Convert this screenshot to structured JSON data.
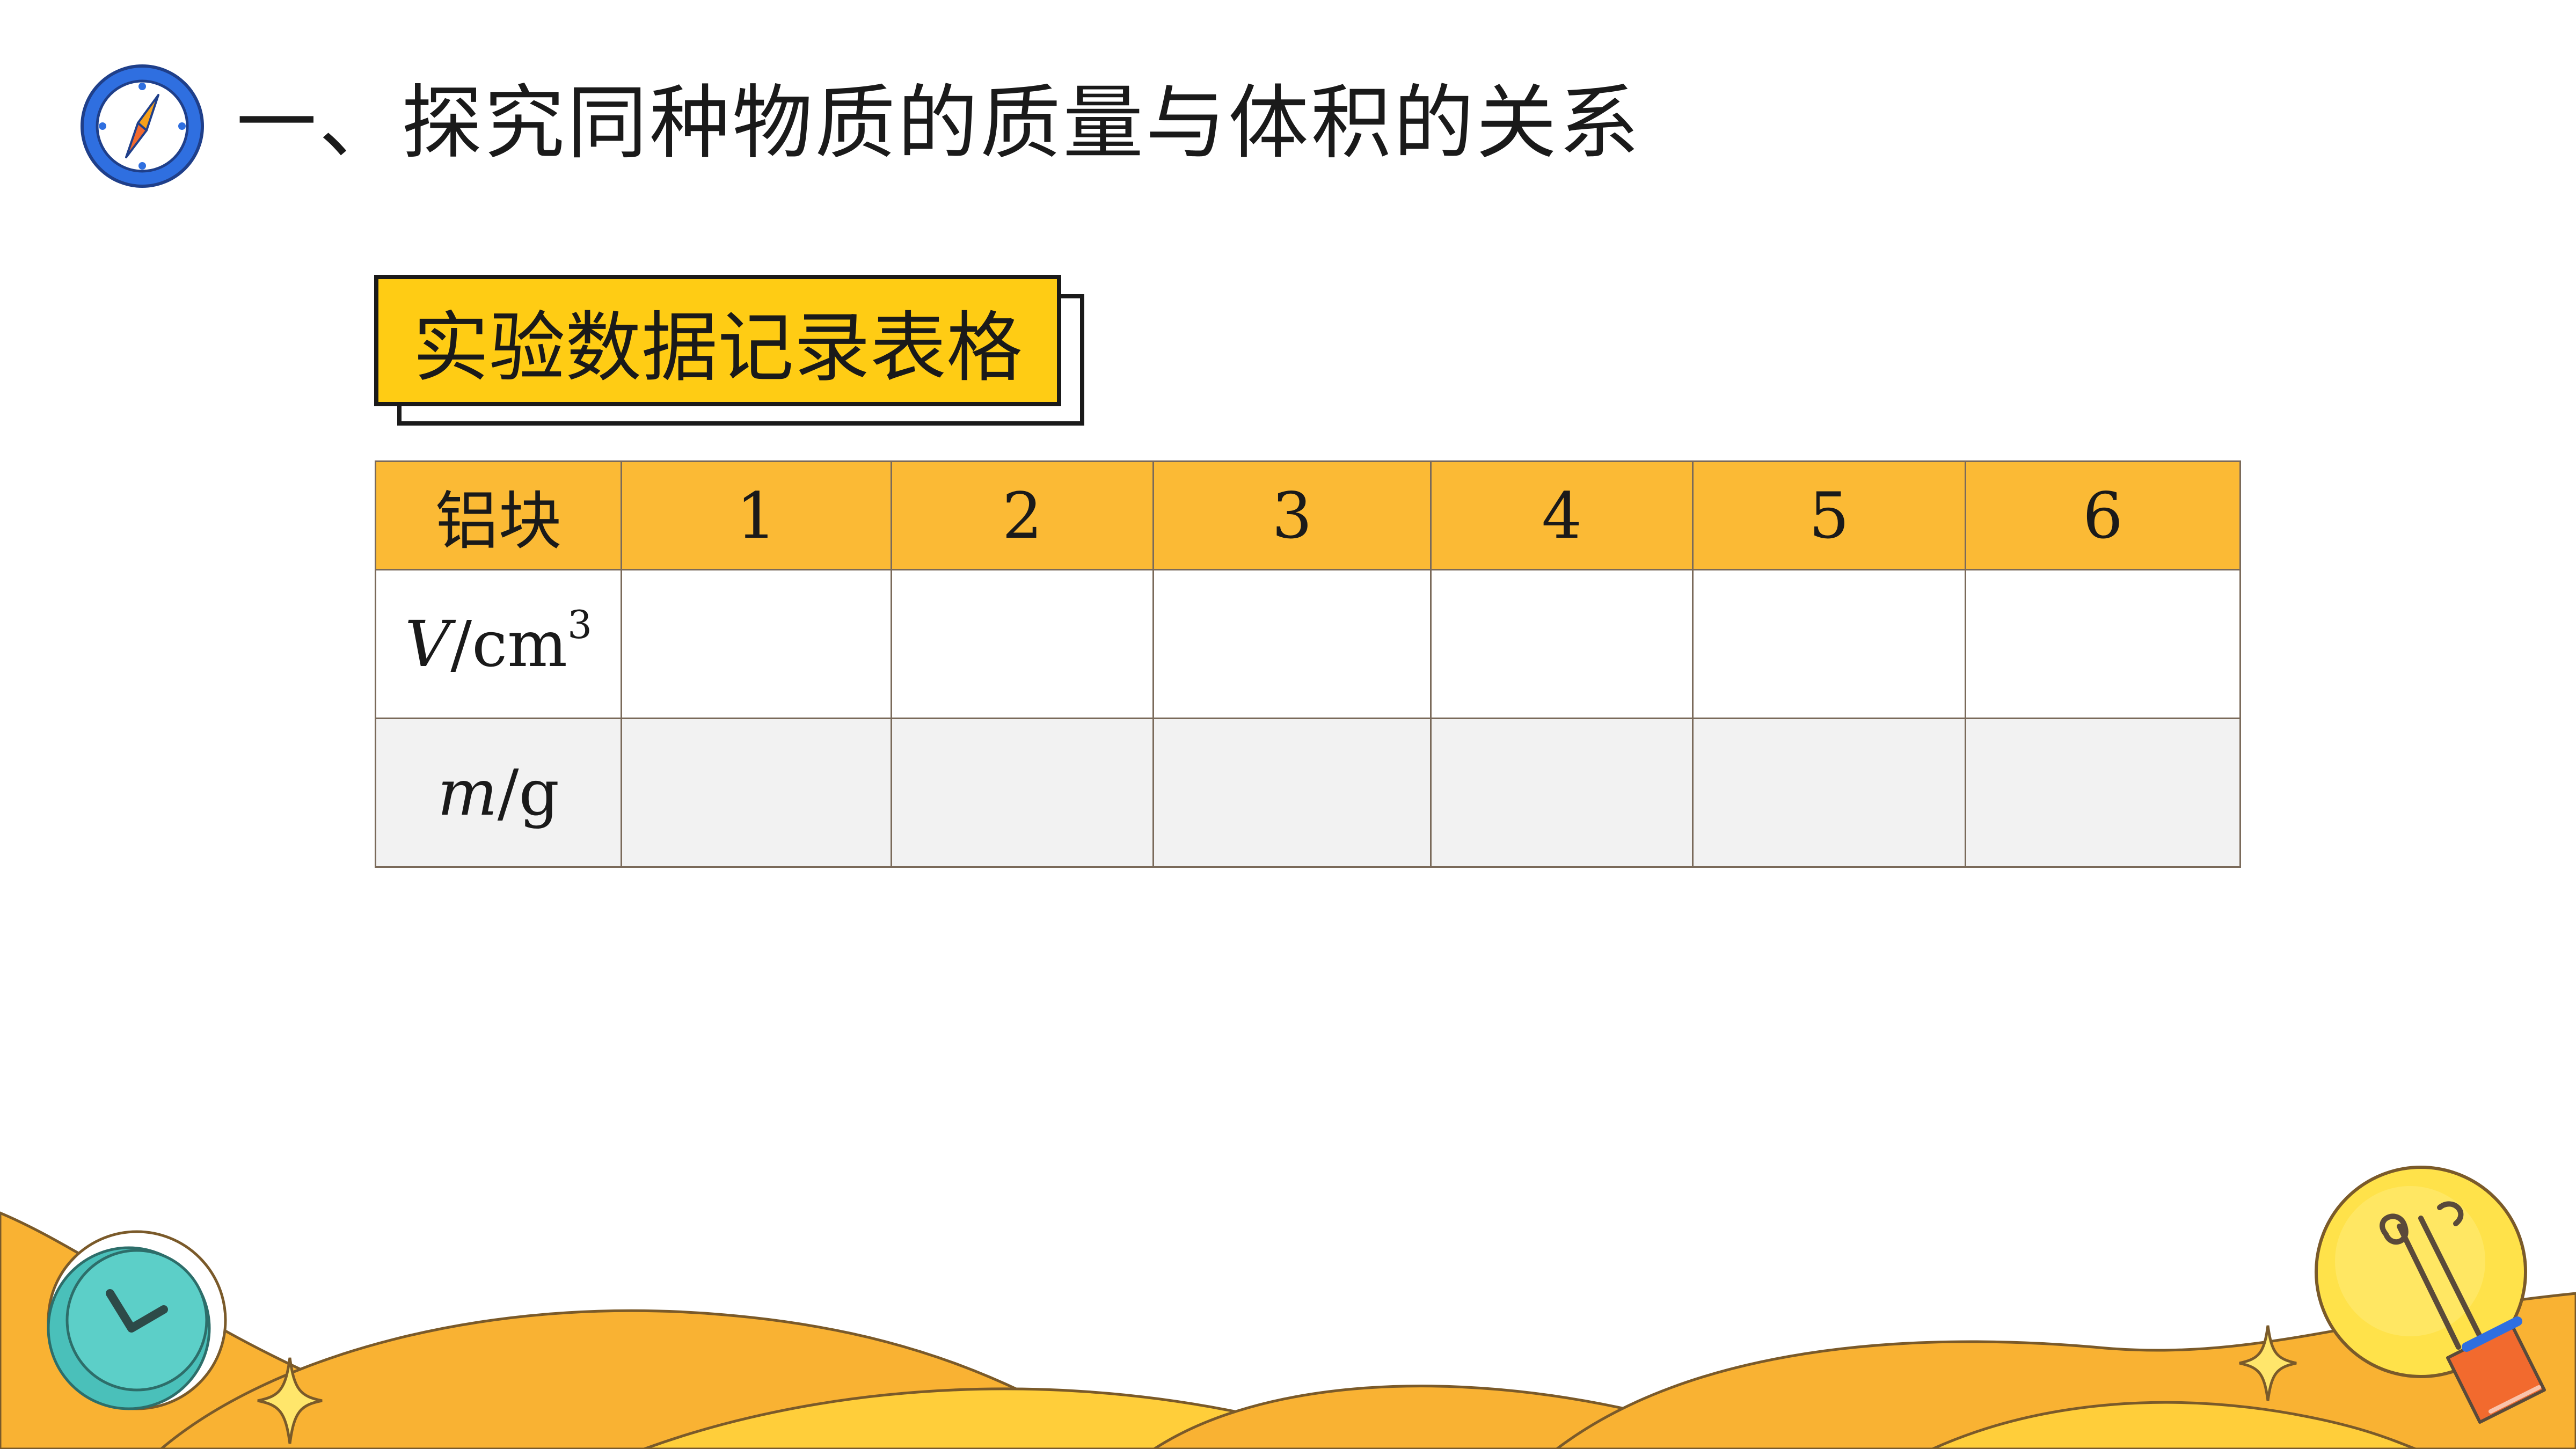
{
  "title": {
    "text": "一、探究同种物质的质量与体积的关系",
    "icon": "compass-icon"
  },
  "label": {
    "text": "实验数据记录表格"
  },
  "table": {
    "header": {
      "label": "铝块",
      "columns": [
        "1",
        "2",
        "3",
        "4",
        "5",
        "6"
      ]
    },
    "rows": [
      {
        "symbol": "V",
        "unit_prefix": "/cm",
        "unit_exponent": "3",
        "values": [
          "",
          "",
          "",
          "",
          "",
          ""
        ]
      },
      {
        "symbol": "m",
        "unit_prefix": "/g",
        "unit_exponent": "",
        "values": [
          "",
          "",
          "",
          "",
          "",
          ""
        ]
      }
    ]
  },
  "decorations": {
    "clock_icon": "clock-icon",
    "lightbulb_icon": "lightbulb-icon",
    "sparkle_icon": "sparkle-icon"
  },
  "colors": {
    "accent_yellow": "#FFCC14",
    "header_orange": "#FBBA35",
    "decor_orange": "#F9B233",
    "decor_yellow": "#FFD24A",
    "clock_teal": "#5CCFC8",
    "compass_blue": "#2F6FE0",
    "row_gray": "#F2F2F2"
  }
}
